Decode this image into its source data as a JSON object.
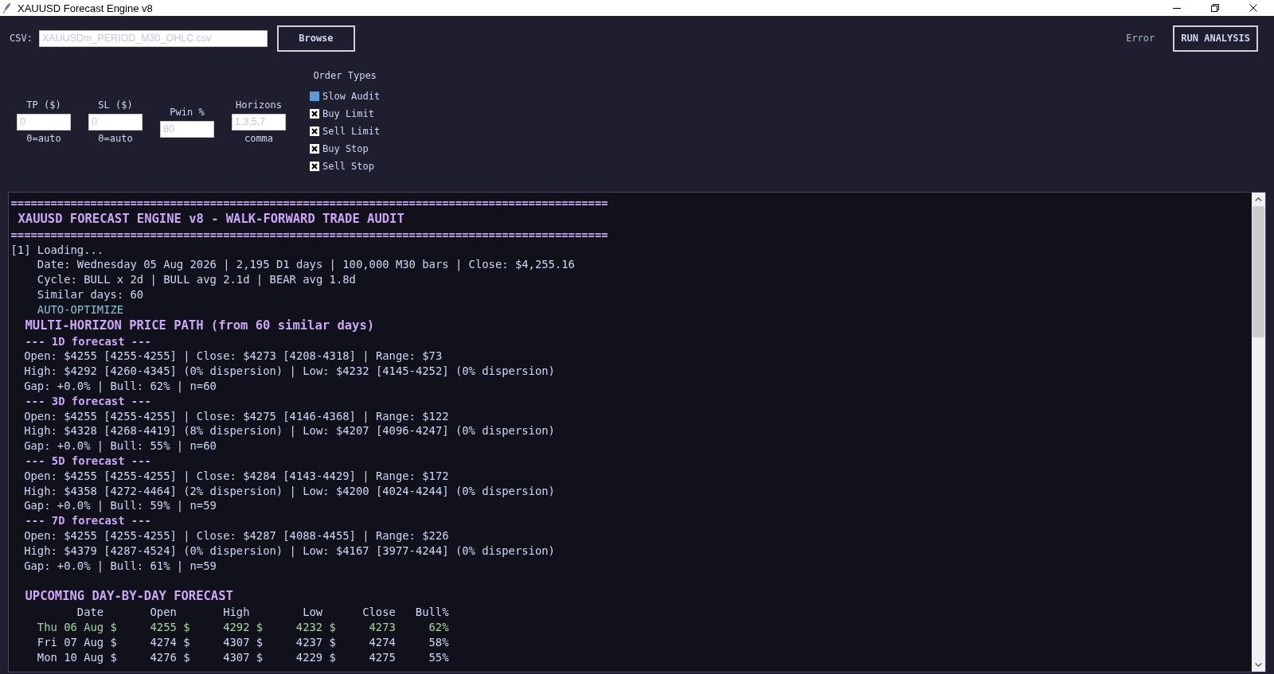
{
  "window": {
    "title": "XAUUSD Forecast Engine v8"
  },
  "file_bar": {
    "label": "CSV:",
    "value": "XAUUSDm_PERIOD_M30_OHLC.csv",
    "browse_button": "Browse",
    "status": "Error",
    "run_button": "RUN ANALYSIS"
  },
  "parameters": [
    {
      "label": "TP ($)",
      "value": "0",
      "hint": "0=auto"
    },
    {
      "label": "SL ($)",
      "value": "0",
      "hint": "0=auto"
    },
    {
      "label": "Pwin %",
      "value": "80"
    },
    {
      "label": "Horizons",
      "value": "1,3,5,7",
      "hint": "comma"
    }
  ],
  "order_types": {
    "title": "Order Types",
    "options": [
      {
        "label": "Slow Audit",
        "checked": false
      },
      {
        "label": "Buy Limit",
        "checked": true
      },
      {
        "label": "Sell Limit",
        "checked": true
      },
      {
        "label": "Buy Stop",
        "checked": true
      },
      {
        "label": "Sell Stop",
        "checked": true
      }
    ]
  },
  "console": {
    "lines": [
      {
        "kind": "rule",
        "text": "=========================================================================================="
      },
      {
        "kind": "title",
        "text": "XAUUSD FORECAST ENGINE v8 - WALK-FORWARD TRADE AUDIT"
      },
      {
        "kind": "rule",
        "text": "=========================================================================================="
      },
      {
        "kind": "step",
        "text": "[1] Loading..."
      },
      {
        "kind": "detail",
        "text": "Date: Wednesday 05 Aug 2026 | 2,195 D1 days | 100,000 M30 bars | Close: $4,255.16"
      },
      {
        "kind": "detail",
        "text": "Cycle: BULL x 2d | BULL avg 2.1d | BEAR avg 1.8d"
      },
      {
        "kind": "detail",
        "text": "Similar days: 60"
      },
      {
        "kind": "note",
        "text": "AUTO-OPTIMIZE"
      },
      {
        "kind": "section",
        "text": "MULTI-HORIZON PRICE PATH (from 60 similar days)"
      },
      {
        "kind": "subsection",
        "text": "--- 1D forecast ---"
      },
      {
        "kind": "body",
        "text": "Open: $4255 [4255-4255] | Close: $4273 [4208-4318] | Range: $73"
      },
      {
        "kind": "body",
        "text": "High: $4292 [4260-4345] (0% dispersion) | Low: $4232 [4145-4252] (0% dispersion)"
      },
      {
        "kind": "body",
        "text": "Gap: +0.0% | Bull: 62% | n=60"
      },
      {
        "kind": "subsection",
        "text": "--- 3D forecast ---"
      },
      {
        "kind": "body",
        "text": "Open: $4255 [4255-4255] | Close: $4275 [4146-4368] | Range: $122"
      },
      {
        "kind": "body",
        "text": "High: $4328 [4268-4419] (8% dispersion) | Low: $4207 [4096-4247] (0% dispersion)"
      },
      {
        "kind": "body",
        "text": "Gap: +0.0% | Bull: 55% | n=60"
      },
      {
        "kind": "subsection",
        "text": "--- 5D forecast ---"
      },
      {
        "kind": "body",
        "text": "Open: $4255 [4255-4255] | Close: $4284 [4143-4429] | Range: $172"
      },
      {
        "kind": "body",
        "text": "High: $4358 [4272-4464] (2% dispersion) | Low: $4200 [4024-4244] (0% dispersion)"
      },
      {
        "kind": "body",
        "text": "Gap: +0.0% | Bull: 59% | n=59"
      },
      {
        "kind": "subsection",
        "text": "--- 7D forecast ---"
      },
      {
        "kind": "body",
        "text": "Open: $4255 [4255-4255] | Close: $4287 [4088-4455] | Range: $226"
      },
      {
        "kind": "body",
        "text": "High: $4379 [4287-4524] (0% dispersion) | Low: $4167 [3977-4244] (0% dispersion)"
      },
      {
        "kind": "body",
        "text": "Gap: +0.0% | Bull: 61% | n=59"
      }
    ],
    "day_forecast": {
      "title": "UPCOMING DAY-BY-DAY FORECAST",
      "columns": [
        "Date",
        "Open",
        "High",
        "Low",
        "Close",
        "Bull%"
      ],
      "rows": [
        {
          "highlighted": true,
          "cells": [
            "Thu 06 Aug $",
            "4255 $",
            "4292 $",
            "4232 $",
            "4273",
            "62%"
          ]
        },
        {
          "highlighted": false,
          "cells": [
            "Fri 07 Aug $",
            "4274 $",
            "4307 $",
            "4237 $",
            "4274",
            "58%"
          ]
        },
        {
          "highlighted": false,
          "cells": [
            "Mon 10 Aug $",
            "4276 $",
            "4307 $",
            "4229 $",
            "4275",
            "55%"
          ]
        }
      ]
    }
  }
}
